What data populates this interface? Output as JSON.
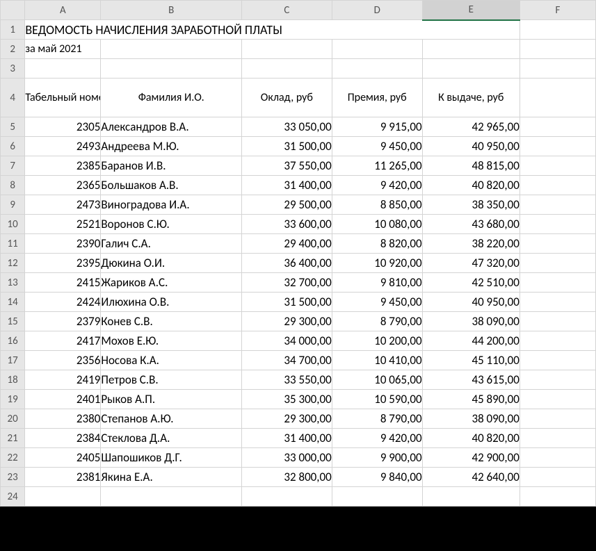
{
  "columns": [
    "A",
    "B",
    "C",
    "D",
    "E",
    "F"
  ],
  "selectedCol": "E",
  "title": "ВЕДОМОСТЬ НАЧИСЛЕНИЯ ЗАРАБОТНОЙ ПЛАТЫ",
  "subtitle": "за май 2021",
  "headers": {
    "a": "Табельный номер",
    "b": "Фамилия И.О.",
    "c": "Оклад, руб",
    "d": "Премия, руб",
    "e": "К выдаче, руб"
  },
  "rows": [
    {
      "num": "2305",
      "name": "Александров В.А.",
      "salary": "33 050,00",
      "bonus": "9 915,00",
      "pay": "42 965,00"
    },
    {
      "num": "2493",
      "name": "Андреева М.Ю.",
      "salary": "31 500,00",
      "bonus": "9 450,00",
      "pay": "40 950,00"
    },
    {
      "num": "2385",
      "name": "Баранов И.В.",
      "salary": "37 550,00",
      "bonus": "11 265,00",
      "pay": "48 815,00"
    },
    {
      "num": "2365",
      "name": "Большаков А.В.",
      "salary": "31 400,00",
      "bonus": "9 420,00",
      "pay": "40 820,00"
    },
    {
      "num": "2473",
      "name": "Виноградова И.А.",
      "salary": "29 500,00",
      "bonus": "8 850,00",
      "pay": "38 350,00"
    },
    {
      "num": "2521",
      "name": "Воронов С.Ю.",
      "salary": "33 600,00",
      "bonus": "10 080,00",
      "pay": "43 680,00"
    },
    {
      "num": "2390",
      "name": "Галич С.А.",
      "salary": "29 400,00",
      "bonus": "8 820,00",
      "pay": "38 220,00"
    },
    {
      "num": "2395",
      "name": "Дюкина О.И.",
      "salary": "36 400,00",
      "bonus": "10 920,00",
      "pay": "47 320,00"
    },
    {
      "num": "2415",
      "name": "Жариков А.С.",
      "salary": "32 700,00",
      "bonus": "9 810,00",
      "pay": "42 510,00"
    },
    {
      "num": "2424",
      "name": "Илюхина О.В.",
      "salary": "31 500,00",
      "bonus": "9 450,00",
      "pay": "40 950,00"
    },
    {
      "num": "2379",
      "name": "Конев С.В.",
      "salary": "29 300,00",
      "bonus": "8 790,00",
      "pay": "38 090,00"
    },
    {
      "num": "2417",
      "name": "Мохов Е.Ю.",
      "salary": "34 000,00",
      "bonus": "10 200,00",
      "pay": "44 200,00"
    },
    {
      "num": "2356",
      "name": "Носова К.А.",
      "salary": "34 700,00",
      "bonus": "10 410,00",
      "pay": "45 110,00"
    },
    {
      "num": "2419",
      "name": "Петров С.В.",
      "salary": "33 550,00",
      "bonus": "10 065,00",
      "pay": "43 615,00"
    },
    {
      "num": "2401",
      "name": "Рыков А.П.",
      "salary": "35 300,00",
      "bonus": "10 590,00",
      "pay": "45 890,00"
    },
    {
      "num": "2380",
      "name": "Степанов А.Ю.",
      "salary": "29 300,00",
      "bonus": "8 790,00",
      "pay": "38 090,00"
    },
    {
      "num": "2384",
      "name": "Стеклова Д.А.",
      "salary": "31 400,00",
      "bonus": "9 420,00",
      "pay": "40 820,00"
    },
    {
      "num": "2405",
      "name": "Шапошиков Д.Г.",
      "salary": "33 000,00",
      "bonus": "9 900,00",
      "pay": "42 900,00"
    },
    {
      "num": "2381",
      "name": "Якина Е.А.",
      "salary": "32 800,00",
      "bonus": "9 840,00",
      "pay": "42 640,00"
    }
  ]
}
